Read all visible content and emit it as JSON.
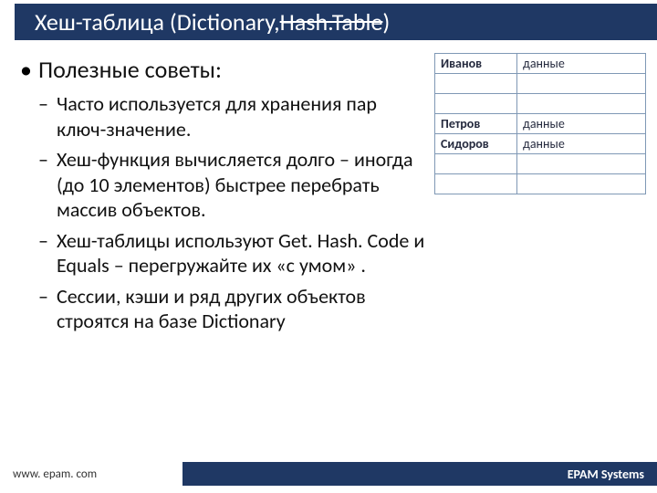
{
  "title": {
    "prefix": "Хеш-таблица (Dictionary, ",
    "strike": "Hash.Table",
    "suffix": ")"
  },
  "tips_heading": "Полезные советы:",
  "tips": [
    "Часто используется для хранения пар ключ-значение.",
    "Хеш-функция вычисляется долго – иногда (до 10 элементов) быстрее перебрать массив объектов.",
    "Хеш-таблицы используют Get. Hash. Code и Equals – перегружайте их «с умом» .",
    "Сессии, кэши и ряд других объектов строятся на базе Dictionary"
  ],
  "table": {
    "rows": [
      {
        "key": "Иванов",
        "value": "данные"
      },
      {
        "key": "",
        "value": ""
      },
      {
        "key": "",
        "value": ""
      },
      {
        "key": "Петров",
        "value": "данные"
      },
      {
        "key": "Сидоров",
        "value": "данные"
      },
      {
        "key": "",
        "value": ""
      },
      {
        "key": "",
        "value": ""
      }
    ]
  },
  "footer": {
    "url": "www. epam. com",
    "brand": "EPAM Systems"
  }
}
